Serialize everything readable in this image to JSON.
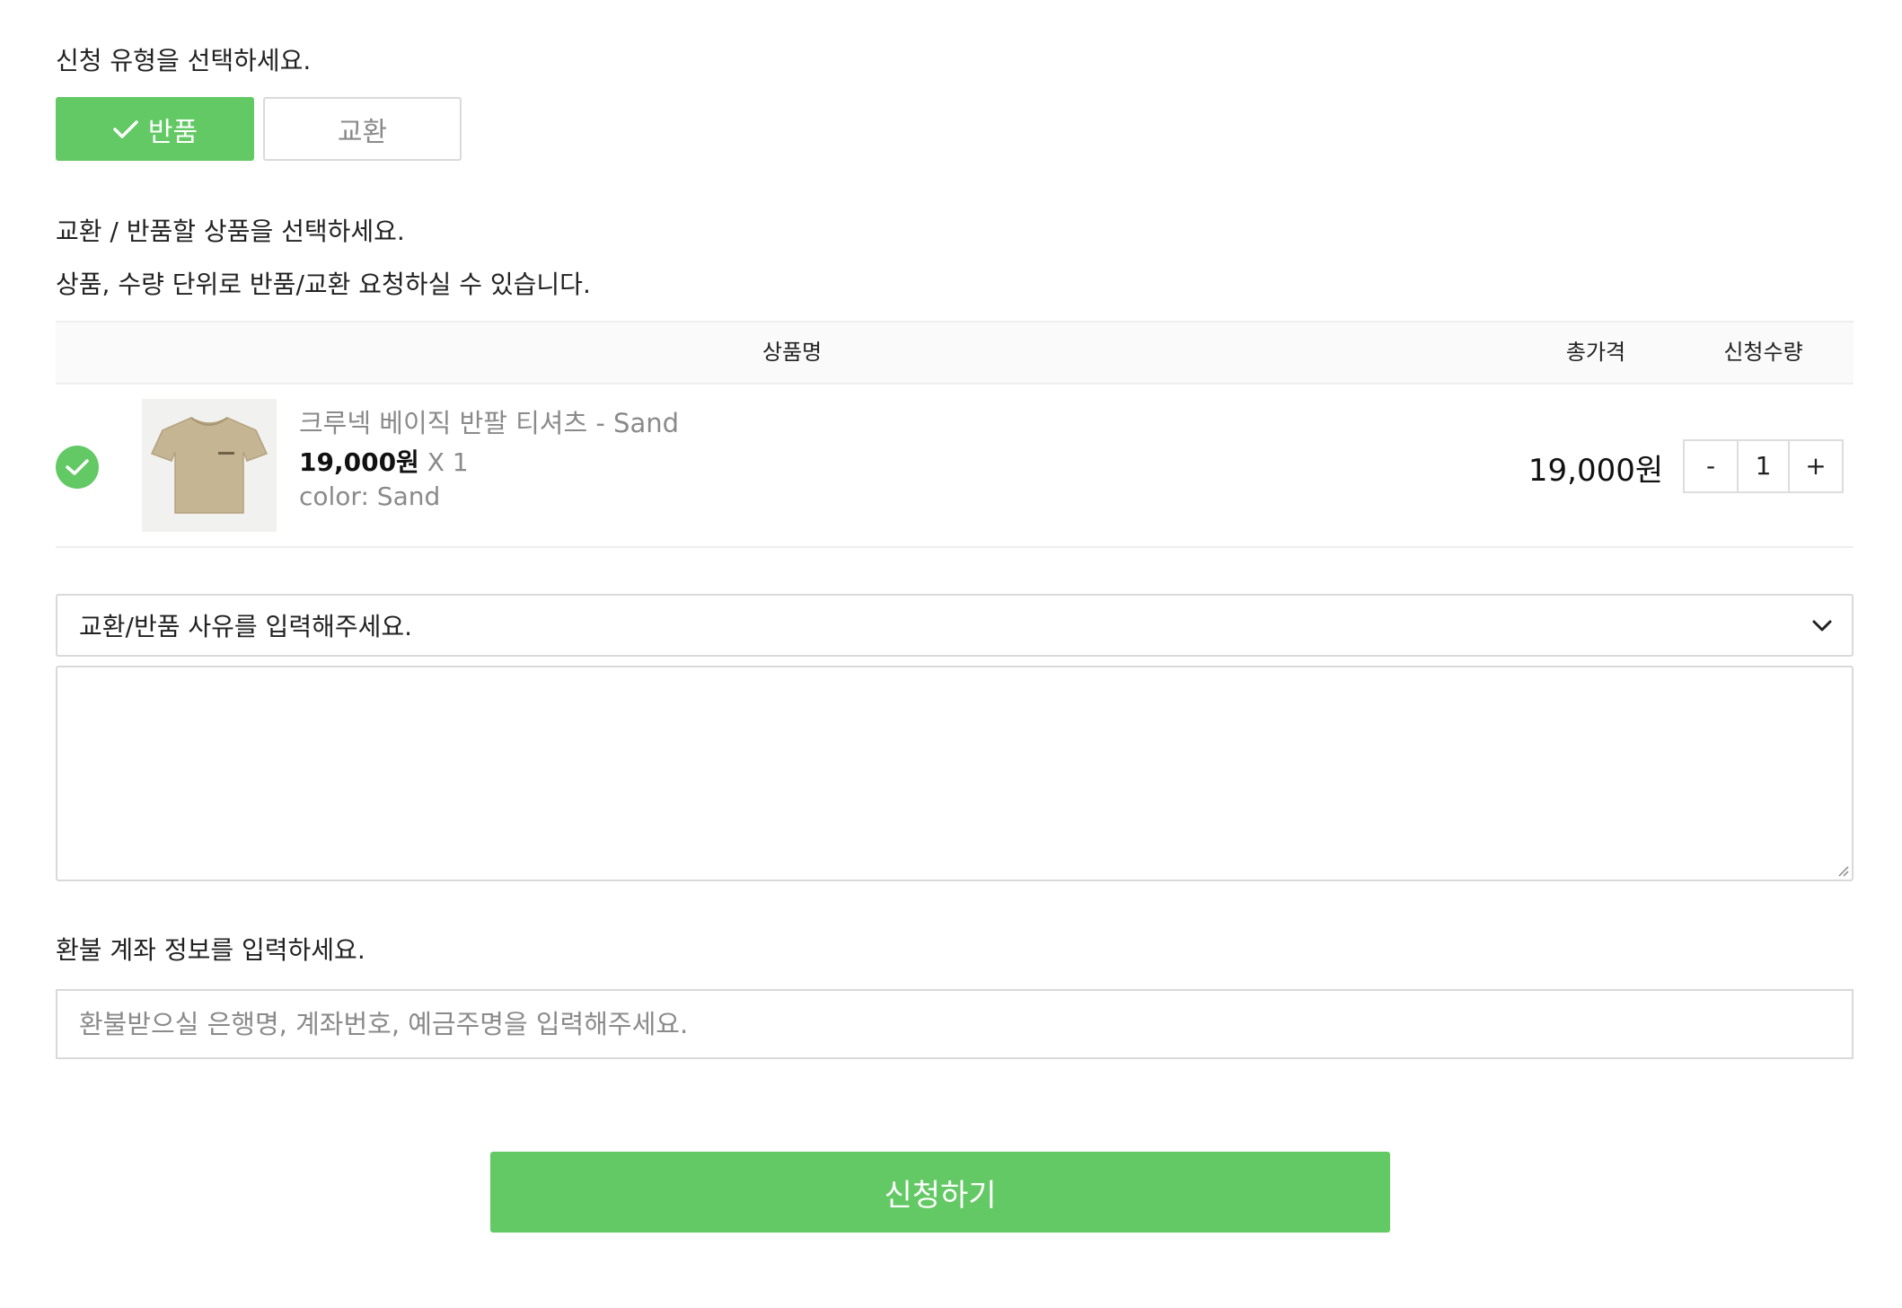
{
  "type_section": {
    "title": "신청 유형을 선택하세요.",
    "options": [
      {
        "label": "반품",
        "selected": true
      },
      {
        "label": "교환",
        "selected": false
      }
    ]
  },
  "product_section": {
    "title": "교환 / 반품할 상품을 선택하세요.",
    "subtitle": "상품, 수량 단위로 반품/교환 요청하실 수 있습니다.",
    "columns": {
      "name": "상품명",
      "total": "총가격",
      "quantity": "신청수량"
    },
    "items": [
      {
        "name": "크루넥 베이직 반팔 티셔츠 - Sand",
        "price": "19,000원",
        "multiplier": "X 1",
        "option": "color: Sand",
        "total": "19,000원",
        "quantity": "1",
        "selected": true
      }
    ],
    "stepper": {
      "minus": "-",
      "plus": "+"
    }
  },
  "reason": {
    "select_value": "교환/반품 사유를 입력해주세요."
  },
  "refund_section": {
    "title": "환불 계좌 정보를 입력하세요.",
    "placeholder": "환불받으실 은행명, 계좌번호, 예금주명을 입력해주세요."
  },
  "submit_label": "신청하기",
  "colors": {
    "accent": "#63c965",
    "muted_text": "#8a8a8a",
    "border": "#d9d9d9",
    "product_tshirt": "#c5b593"
  },
  "icons": {
    "selected_type": "check-icon",
    "item_selected": "check-circle-icon",
    "select": "chevron-down-icon",
    "textarea": "resize-grip-icon"
  }
}
